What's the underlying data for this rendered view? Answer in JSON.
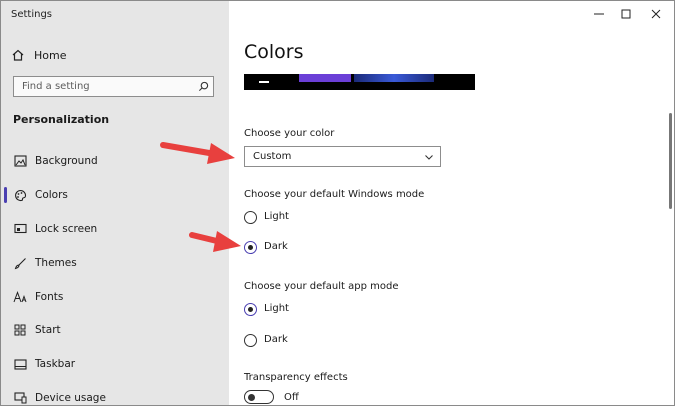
{
  "window": {
    "title": "Settings"
  },
  "sidebar": {
    "home_label": "Home",
    "search_placeholder": "Find a setting",
    "section_label": "Personalization",
    "items": [
      {
        "label": "Background",
        "icon": "image-icon"
      },
      {
        "label": "Colors",
        "icon": "palette-icon",
        "active": true
      },
      {
        "label": "Lock screen",
        "icon": "lock-screen-icon"
      },
      {
        "label": "Themes",
        "icon": "brush-icon"
      },
      {
        "label": "Fonts",
        "icon": "font-icon"
      },
      {
        "label": "Start",
        "icon": "start-icon"
      },
      {
        "label": "Taskbar",
        "icon": "taskbar-icon"
      },
      {
        "label": "Device usage",
        "icon": "device-usage-icon"
      }
    ]
  },
  "main": {
    "title": "Colors",
    "choose_color": {
      "label": "Choose your color",
      "value": "Custom"
    },
    "windows_mode": {
      "label": "Choose your default Windows mode",
      "options": [
        "Light",
        "Dark"
      ],
      "selected": "Dark"
    },
    "app_mode": {
      "label": "Choose your default app mode",
      "options": [
        "Light",
        "Dark"
      ],
      "selected": "Light"
    },
    "transparency": {
      "label": "Transparency effects",
      "state": "Off"
    }
  },
  "colors": {
    "accent": "#4a3fb1",
    "annotation_arrow": "#e8403e",
    "sidebar_bg": "#e6e6e6"
  }
}
